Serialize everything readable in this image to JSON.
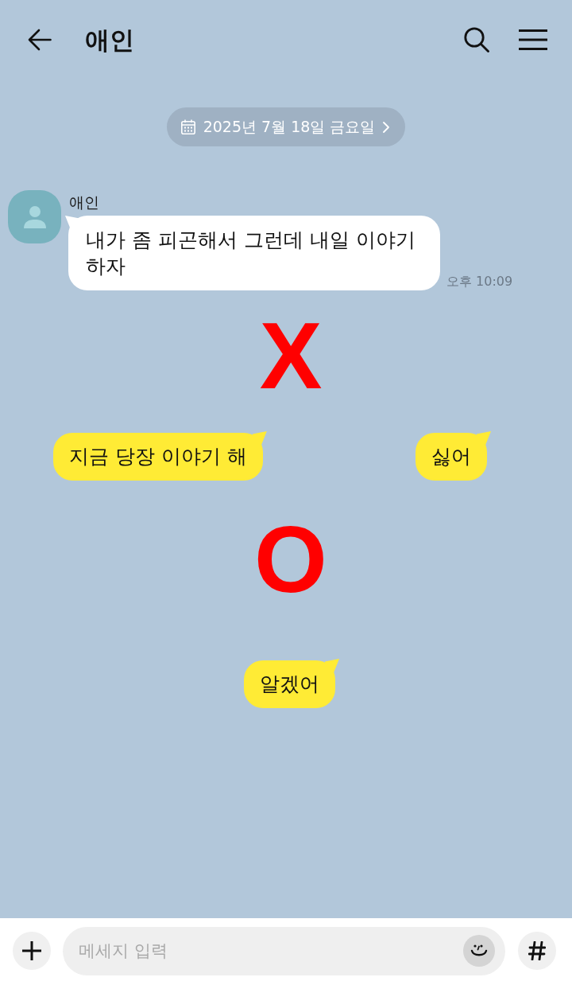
{
  "header": {
    "title": "애인"
  },
  "date_divider": {
    "label": "2025년 7월 18일 금요일"
  },
  "messages": [
    {
      "kind": "received",
      "sender": "애인",
      "text": "내가 좀 피곤해서 그런데 내일 이야기 하자",
      "time": "오후 10:09"
    }
  ],
  "overlay": {
    "top_mark": "X",
    "choices": [
      "지금 당장 이야기 해",
      "싫어"
    ],
    "bottom_mark": "O",
    "answer": "알겠어"
  },
  "composer": {
    "placeholder": "메세지 입력"
  }
}
